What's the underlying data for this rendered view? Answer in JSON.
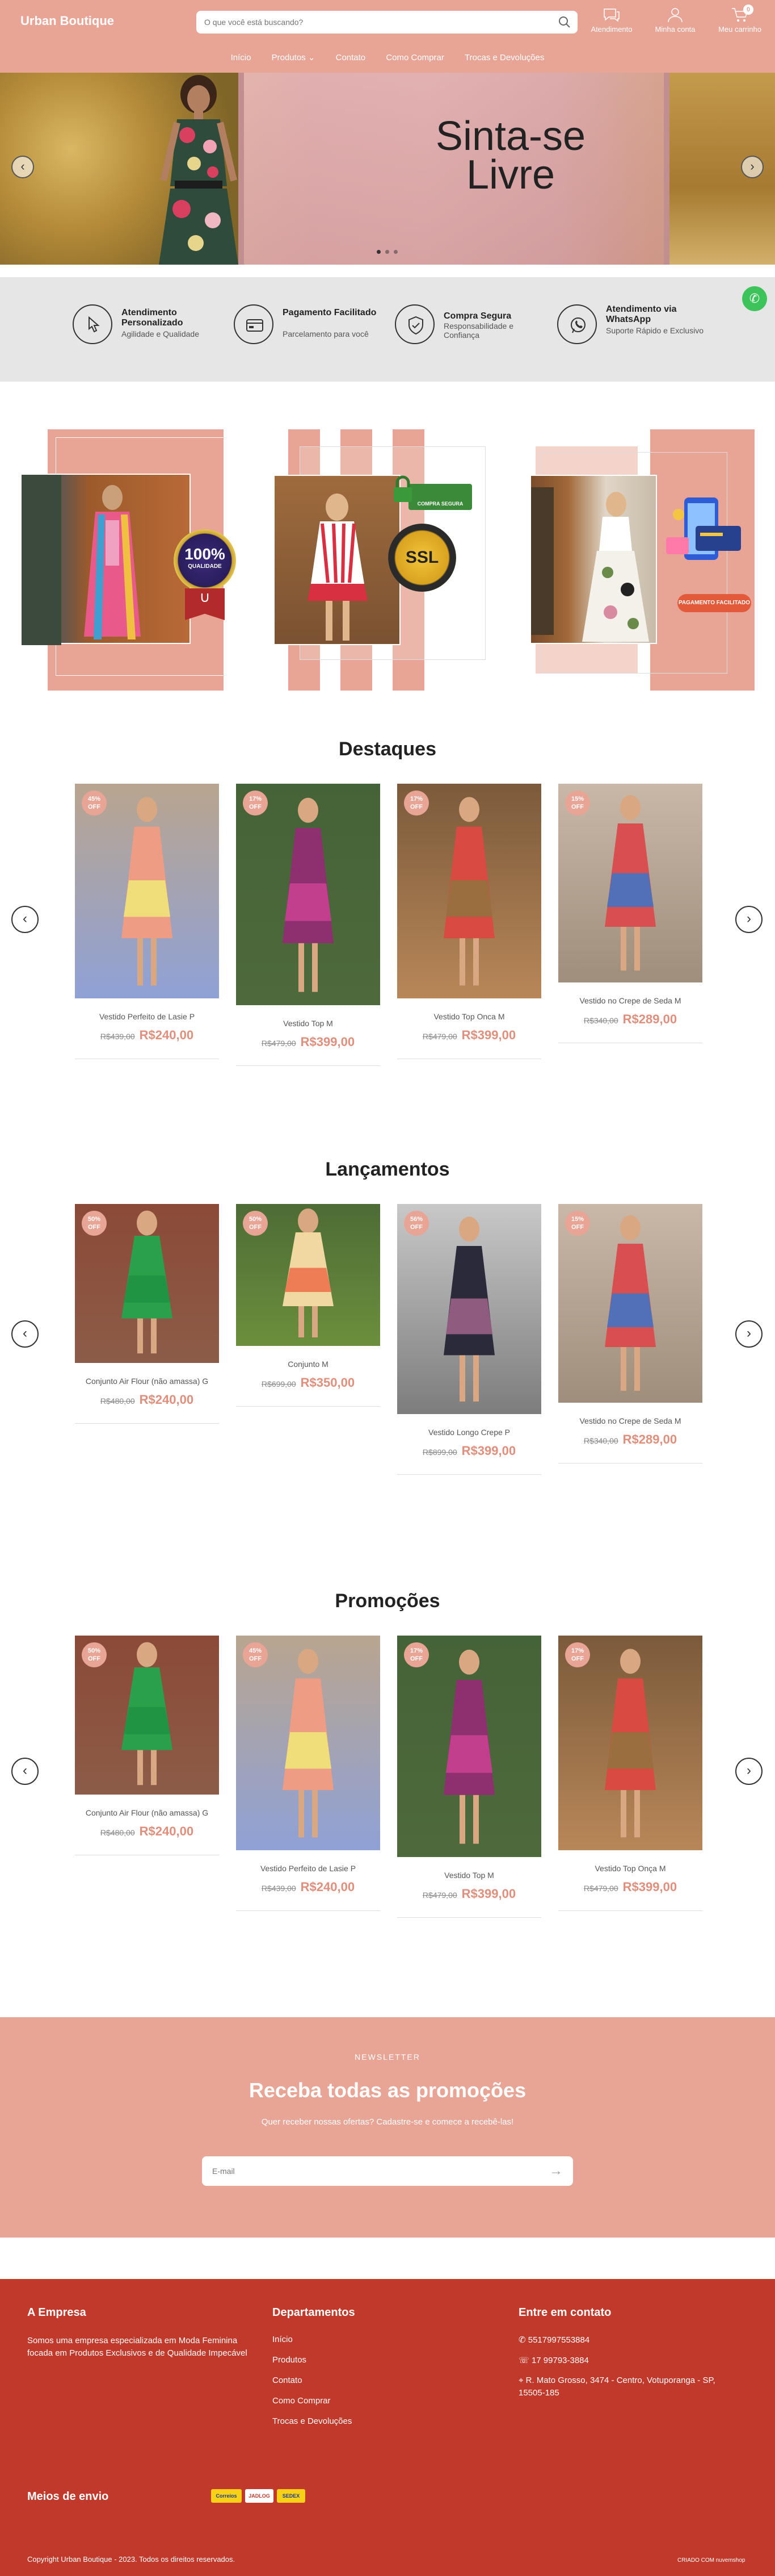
{
  "header": {
    "logo": "Urban Boutique",
    "search_placeholder": "O que você está buscando?",
    "icons": [
      {
        "name": "chat-icon",
        "label": "Atendimento"
      },
      {
        "name": "user-icon",
        "label": "Minha conta"
      },
      {
        "name": "cart-icon",
        "label": "Meu carrinho"
      }
    ],
    "cart_count": "0",
    "nav": [
      "Início",
      "Produtos",
      "Contato",
      "Como Comprar",
      "Trocas e Devoluções"
    ]
  },
  "hero": {
    "text_line1": "Sinta-se",
    "text_line2": "Livre"
  },
  "benefits": [
    {
      "icon": "pointer-icon",
      "title": "Atendimento Personalizado",
      "subtitle": "Agilidade e Qualidade"
    },
    {
      "icon": "card-icon",
      "title": "Pagamento Facilitado",
      "subtitle": "Parcelamento para você"
    },
    {
      "icon": "shield-check-icon",
      "title": "Compra Segura",
      "subtitle": "Responsabilidade e Confiança"
    },
    {
      "icon": "whatsapp-icon",
      "title": "Atendimento via WhatsApp",
      "subtitle": "Suporte Rápido e Exclusivo"
    }
  ],
  "banners": {
    "seal1": "100%",
    "seal1_sub": "QUALIDADE",
    "seal2": "SSL",
    "seal2_sub": "COMPRA SEGURA",
    "seal3": "PAGAMENTO FACILITADO"
  },
  "sections": [
    {
      "title": "Destaques",
      "products": [
        {
          "name": "Vestido Perfeito de Lasie P",
          "old": "R$439,00",
          "new": "R$240,00",
          "badge": "45% OFF",
          "colors": [
            "#b9a58f",
            "#ee9d84",
            "#f0de7a",
            "#8fa1d6"
          ]
        },
        {
          "name": "Vestido Top M",
          "old": "R$479,00",
          "new": "R$399,00",
          "badge": "17% OFF",
          "colors": [
            "#456338",
            "#8e2f6f",
            "#c23f8e",
            "#4e6a3c"
          ]
        },
        {
          "name": "Vestido Top Onca M",
          "old": "R$479,00",
          "new": "R$399,00",
          "badge": "17% OFF",
          "colors": [
            "#7b5a3b",
            "#d84a42",
            "#9b6e3f",
            "#b88758"
          ]
        },
        {
          "name": "Vestido no Crepe de Seda M",
          "old": "R$340,00",
          "new": "R$289,00",
          "badge": "15% OFF",
          "colors": [
            "#c9b8a8",
            "#d94f4f",
            "#5170b8",
            "#a08e7c"
          ]
        }
      ]
    },
    {
      "title": "Lançamentos",
      "products": [
        {
          "name": "Conjunto Air Flour (não amassa) G",
          "old": "R$480,00",
          "new": "R$240,00",
          "badge": "50% OFF",
          "colors": [
            "#8b4a37",
            "#2aa04a",
            "#219443",
            "#8c5c48"
          ]
        },
        {
          "name": "Conjunto M",
          "old": "R$699,00",
          "new": "R$350,00",
          "badge": "50% OFF",
          "colors": [
            "#4d6c36",
            "#f0d8a0",
            "#ee7d55",
            "#6b8f3c"
          ]
        },
        {
          "name": "Vestido Longo Crepe P",
          "old": "R$899,00",
          "new": "R$399,00",
          "badge": "56% OFF",
          "colors": [
            "#c8c8c8",
            "#2a2a3a",
            "#8f5b7e",
            "#7d7d7d"
          ]
        },
        {
          "name": "Vestido no Crepe de Seda M",
          "old": "R$340,00",
          "new": "R$289,00",
          "badge": "15% OFF",
          "colors": [
            "#c9b8a8",
            "#d94f4f",
            "#5170b8",
            "#a08e7c"
          ]
        }
      ]
    },
    {
      "title": "Promoções",
      "products": [
        {
          "name": "Conjunto Air Flour (não amassa) G",
          "old": "R$480,00",
          "new": "R$240,00",
          "badge": "50% OFF",
          "colors": [
            "#8b4a37",
            "#2aa04a",
            "#219443",
            "#8c5c48"
          ]
        },
        {
          "name": "Vestido Perfeito de Lasie P",
          "old": "R$439,00",
          "new": "R$240,00",
          "badge": "45% OFF",
          "colors": [
            "#b9a58f",
            "#ee9d84",
            "#f0de7a",
            "#8fa1d6"
          ]
        },
        {
          "name": "Vestido Top M",
          "old": "R$479,00",
          "new": "R$399,00",
          "badge": "17% OFF",
          "colors": [
            "#456338",
            "#8e2f6f",
            "#c23f8e",
            "#4e6a3c"
          ]
        },
        {
          "name": "Vestido Top Onça M",
          "old": "R$479,00",
          "new": "R$399,00",
          "badge": "17% OFF",
          "colors": [
            "#7b5a3b",
            "#d84a42",
            "#9b6e3f",
            "#b88758"
          ]
        }
      ]
    }
  ],
  "newsletter": {
    "label": "NEWSLETTER",
    "title": "Receba todas as promoções",
    "subtitle": "Quer receber nossas ofertas? Cadastre-se e comece a recebê-las!",
    "placeholder": "E-mail"
  },
  "footer": {
    "company_title": "A Empresa",
    "company_text": "Somos uma empresa especializada em Moda Feminina focada em Produtos Exclusivos e de Qualidade Impecável",
    "dept_title": "Departamentos",
    "dept_links": [
      "Início",
      "Produtos",
      "Contato",
      "Como Comprar",
      "Trocas e Devoluções"
    ],
    "contact_title": "Entre em contato",
    "contact": [
      "5517997553884",
      "17 99793-3884",
      "R. Mato Grosso, 3474 - Centro, Votuporanga - SP, 15505-185"
    ],
    "shipping_title": "Meios de envio",
    "shipping": [
      "Correios",
      "JADLOG",
      "SEDEX"
    ],
    "copyright": "Copyright Urban Boutique - 2023. Todos os direitos reservados.",
    "credits": "CRIADO COM nuvemshop"
  },
  "colors": {
    "accent": "#e8a596",
    "price": "#e08f7d",
    "footer": "#c0392b"
  }
}
